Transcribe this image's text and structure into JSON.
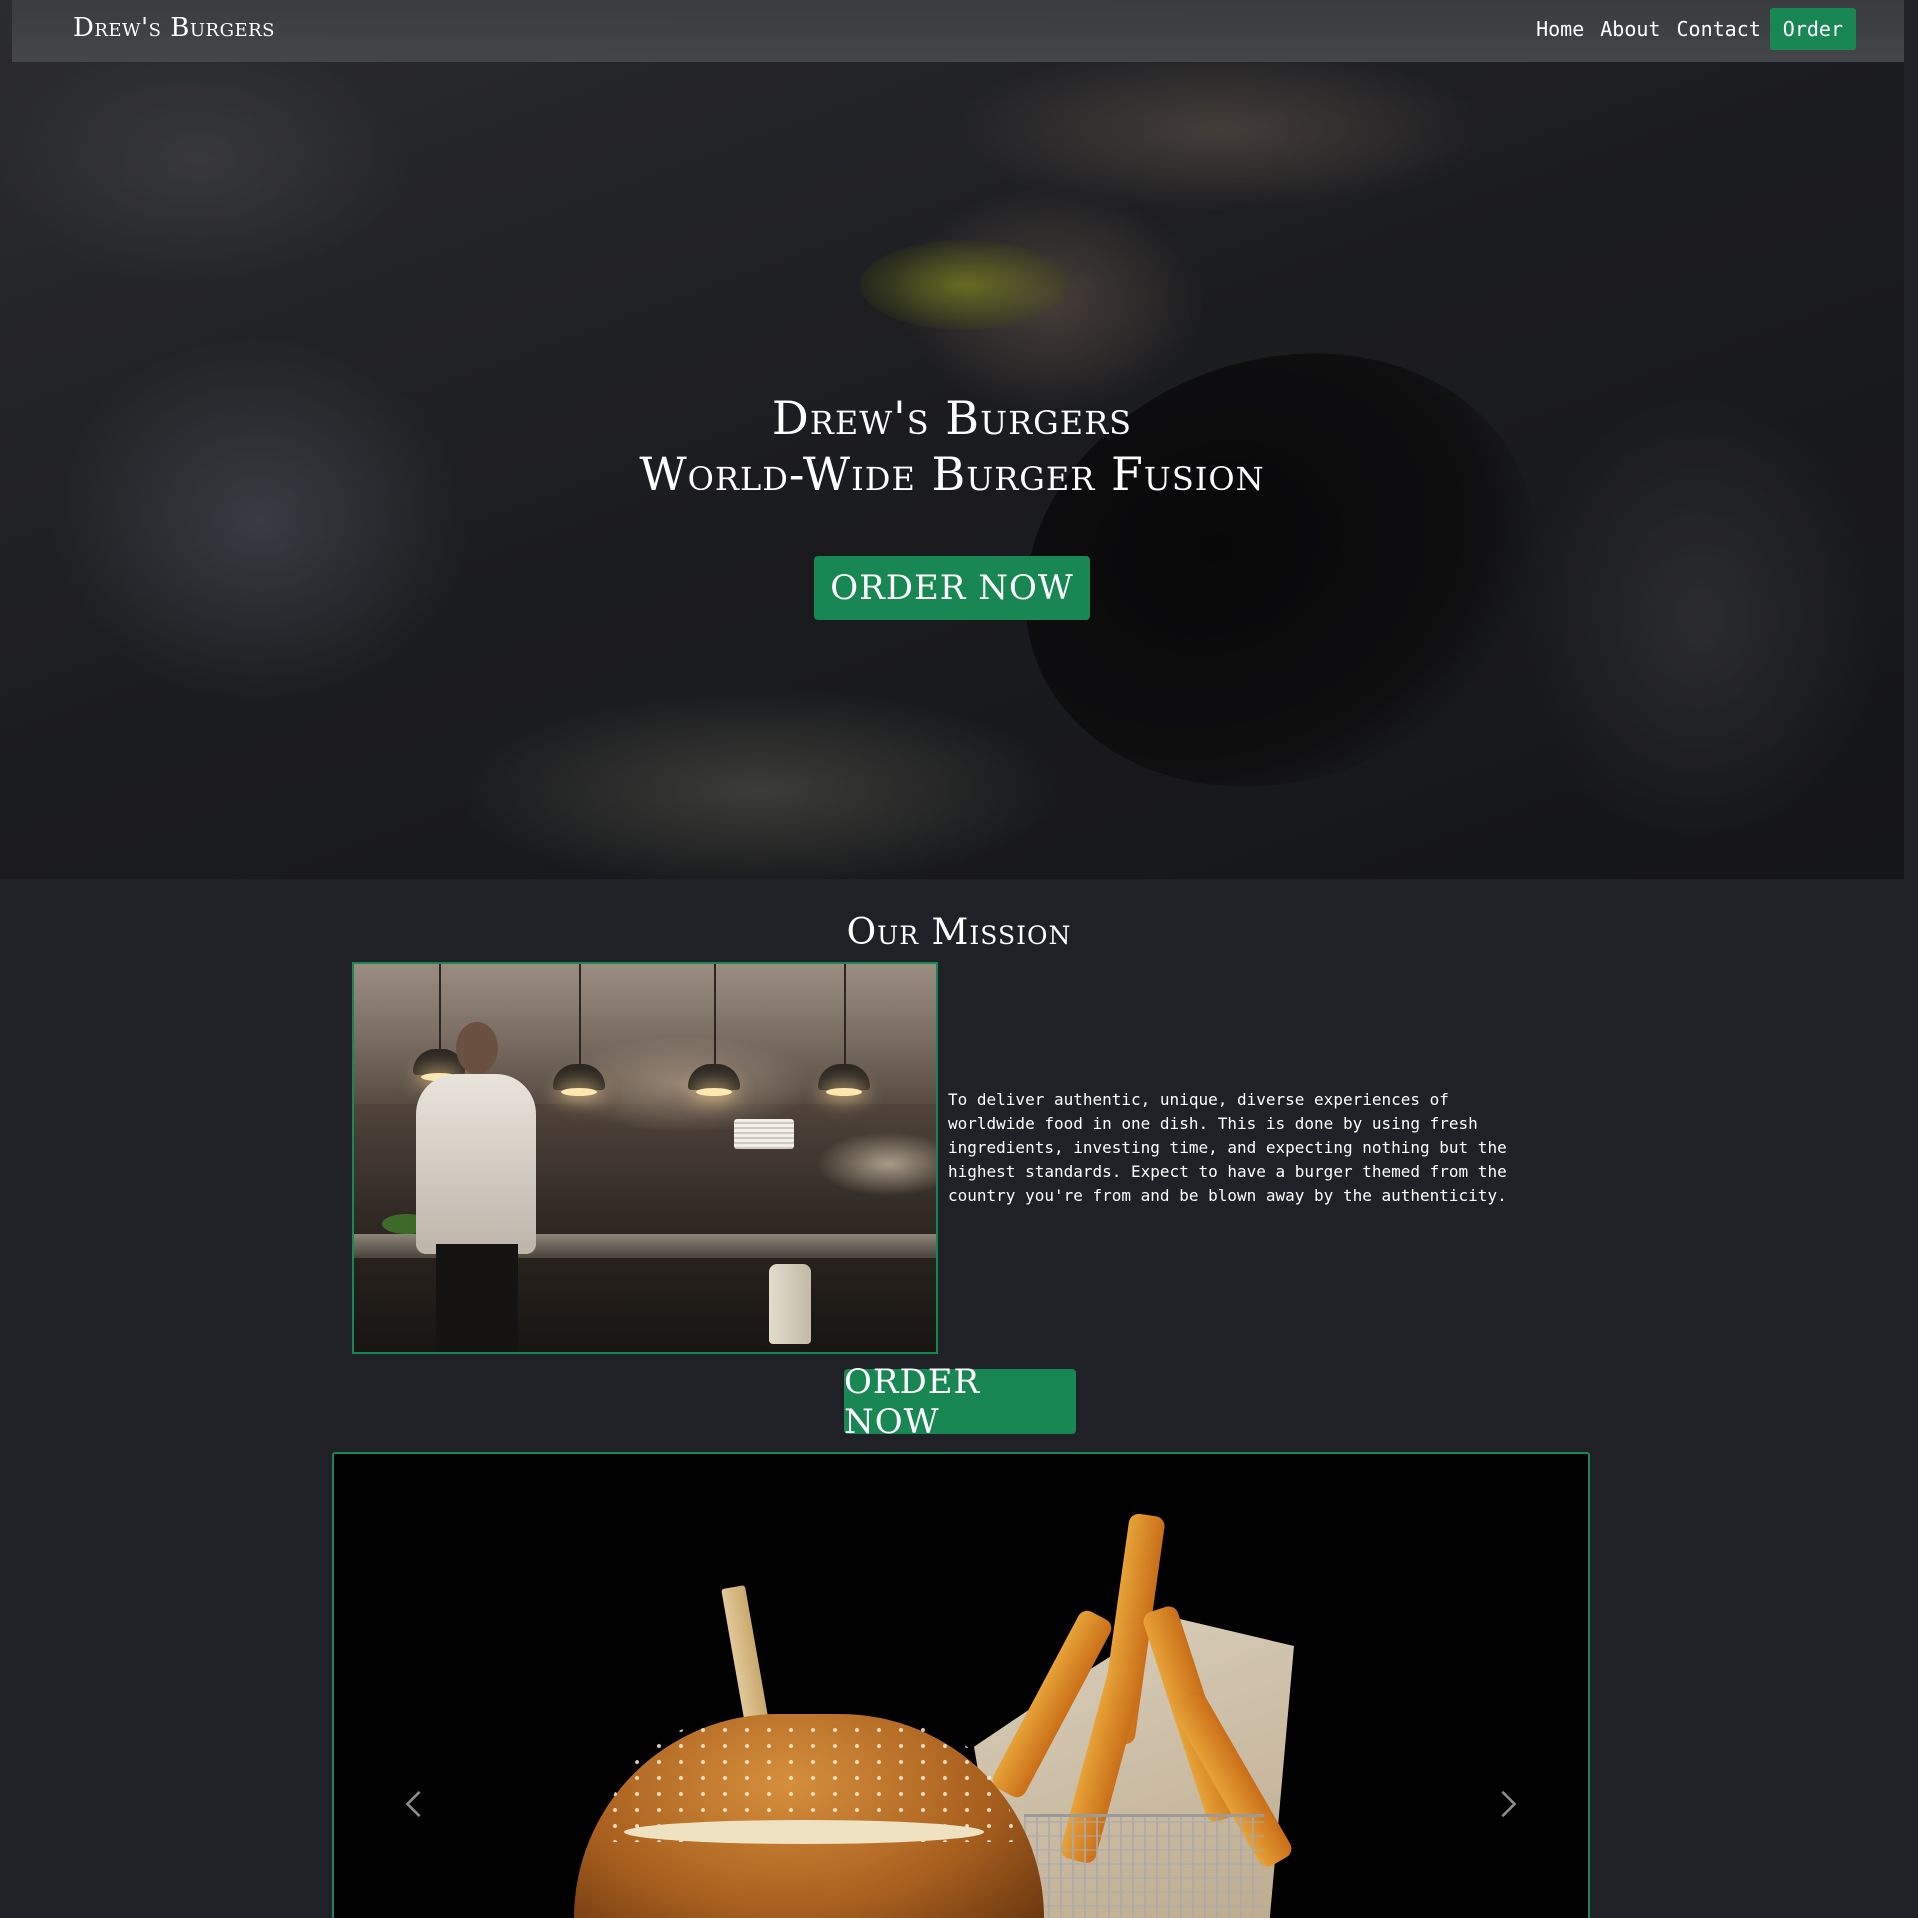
{
  "navbar": {
    "brand": "Drew's Burgers",
    "links": [
      "Home",
      "About",
      "Contact"
    ],
    "order_label": "Order"
  },
  "hero": {
    "title_line1": "Drew's Burgers",
    "title_line2": "World-Wide Burger Fusion",
    "cta_label": "ORDER NOW"
  },
  "mission": {
    "heading": "Our Mission",
    "text": "To deliver authentic, unique, diverse experiences of worldwide food in one dish. This is done by using fresh ingredients, investing time, and expecting nothing but the highest standards. Expect to have a burger themed from the country you're from and be blown away by the authenticity.",
    "cta_label": "ORDER NOW"
  },
  "carousel": {
    "prev_icon": "chevron-left-icon",
    "next_icon": "chevron-right-icon"
  },
  "colors": {
    "accent": "#198754",
    "background": "#1f2126",
    "navbar": "#3c3e42",
    "text": "#ffffff"
  }
}
